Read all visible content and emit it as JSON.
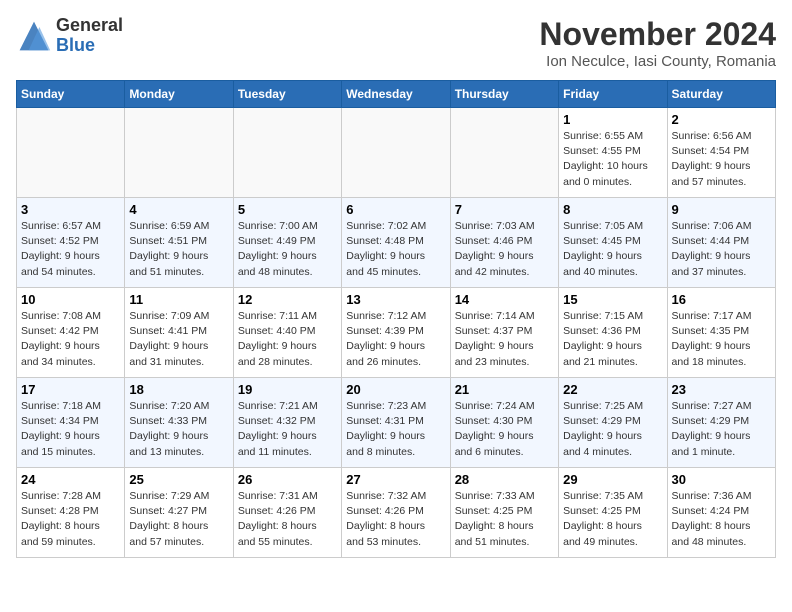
{
  "header": {
    "logo_line1": "General",
    "logo_line2": "Blue",
    "month_title": "November 2024",
    "subtitle": "Ion Neculce, Iasi County, Romania"
  },
  "days_of_week": [
    "Sunday",
    "Monday",
    "Tuesday",
    "Wednesday",
    "Thursday",
    "Friday",
    "Saturday"
  ],
  "weeks": [
    [
      {
        "day": "",
        "info": ""
      },
      {
        "day": "",
        "info": ""
      },
      {
        "day": "",
        "info": ""
      },
      {
        "day": "",
        "info": ""
      },
      {
        "day": "",
        "info": ""
      },
      {
        "day": "1",
        "info": "Sunrise: 6:55 AM\nSunset: 4:55 PM\nDaylight: 10 hours\nand 0 minutes."
      },
      {
        "day": "2",
        "info": "Sunrise: 6:56 AM\nSunset: 4:54 PM\nDaylight: 9 hours\nand 57 minutes."
      }
    ],
    [
      {
        "day": "3",
        "info": "Sunrise: 6:57 AM\nSunset: 4:52 PM\nDaylight: 9 hours\nand 54 minutes."
      },
      {
        "day": "4",
        "info": "Sunrise: 6:59 AM\nSunset: 4:51 PM\nDaylight: 9 hours\nand 51 minutes."
      },
      {
        "day": "5",
        "info": "Sunrise: 7:00 AM\nSunset: 4:49 PM\nDaylight: 9 hours\nand 48 minutes."
      },
      {
        "day": "6",
        "info": "Sunrise: 7:02 AM\nSunset: 4:48 PM\nDaylight: 9 hours\nand 45 minutes."
      },
      {
        "day": "7",
        "info": "Sunrise: 7:03 AM\nSunset: 4:46 PM\nDaylight: 9 hours\nand 42 minutes."
      },
      {
        "day": "8",
        "info": "Sunrise: 7:05 AM\nSunset: 4:45 PM\nDaylight: 9 hours\nand 40 minutes."
      },
      {
        "day": "9",
        "info": "Sunrise: 7:06 AM\nSunset: 4:44 PM\nDaylight: 9 hours\nand 37 minutes."
      }
    ],
    [
      {
        "day": "10",
        "info": "Sunrise: 7:08 AM\nSunset: 4:42 PM\nDaylight: 9 hours\nand 34 minutes."
      },
      {
        "day": "11",
        "info": "Sunrise: 7:09 AM\nSunset: 4:41 PM\nDaylight: 9 hours\nand 31 minutes."
      },
      {
        "day": "12",
        "info": "Sunrise: 7:11 AM\nSunset: 4:40 PM\nDaylight: 9 hours\nand 28 minutes."
      },
      {
        "day": "13",
        "info": "Sunrise: 7:12 AM\nSunset: 4:39 PM\nDaylight: 9 hours\nand 26 minutes."
      },
      {
        "day": "14",
        "info": "Sunrise: 7:14 AM\nSunset: 4:37 PM\nDaylight: 9 hours\nand 23 minutes."
      },
      {
        "day": "15",
        "info": "Sunrise: 7:15 AM\nSunset: 4:36 PM\nDaylight: 9 hours\nand 21 minutes."
      },
      {
        "day": "16",
        "info": "Sunrise: 7:17 AM\nSunset: 4:35 PM\nDaylight: 9 hours\nand 18 minutes."
      }
    ],
    [
      {
        "day": "17",
        "info": "Sunrise: 7:18 AM\nSunset: 4:34 PM\nDaylight: 9 hours\nand 15 minutes."
      },
      {
        "day": "18",
        "info": "Sunrise: 7:20 AM\nSunset: 4:33 PM\nDaylight: 9 hours\nand 13 minutes."
      },
      {
        "day": "19",
        "info": "Sunrise: 7:21 AM\nSunset: 4:32 PM\nDaylight: 9 hours\nand 11 minutes."
      },
      {
        "day": "20",
        "info": "Sunrise: 7:23 AM\nSunset: 4:31 PM\nDaylight: 9 hours\nand 8 minutes."
      },
      {
        "day": "21",
        "info": "Sunrise: 7:24 AM\nSunset: 4:30 PM\nDaylight: 9 hours\nand 6 minutes."
      },
      {
        "day": "22",
        "info": "Sunrise: 7:25 AM\nSunset: 4:29 PM\nDaylight: 9 hours\nand 4 minutes."
      },
      {
        "day": "23",
        "info": "Sunrise: 7:27 AM\nSunset: 4:29 PM\nDaylight: 9 hours\nand 1 minute."
      }
    ],
    [
      {
        "day": "24",
        "info": "Sunrise: 7:28 AM\nSunset: 4:28 PM\nDaylight: 8 hours\nand 59 minutes."
      },
      {
        "day": "25",
        "info": "Sunrise: 7:29 AM\nSunset: 4:27 PM\nDaylight: 8 hours\nand 57 minutes."
      },
      {
        "day": "26",
        "info": "Sunrise: 7:31 AM\nSunset: 4:26 PM\nDaylight: 8 hours\nand 55 minutes."
      },
      {
        "day": "27",
        "info": "Sunrise: 7:32 AM\nSunset: 4:26 PM\nDaylight: 8 hours\nand 53 minutes."
      },
      {
        "day": "28",
        "info": "Sunrise: 7:33 AM\nSunset: 4:25 PM\nDaylight: 8 hours\nand 51 minutes."
      },
      {
        "day": "29",
        "info": "Sunrise: 7:35 AM\nSunset: 4:25 PM\nDaylight: 8 hours\nand 49 minutes."
      },
      {
        "day": "30",
        "info": "Sunrise: 7:36 AM\nSunset: 4:24 PM\nDaylight: 8 hours\nand 48 minutes."
      }
    ]
  ]
}
